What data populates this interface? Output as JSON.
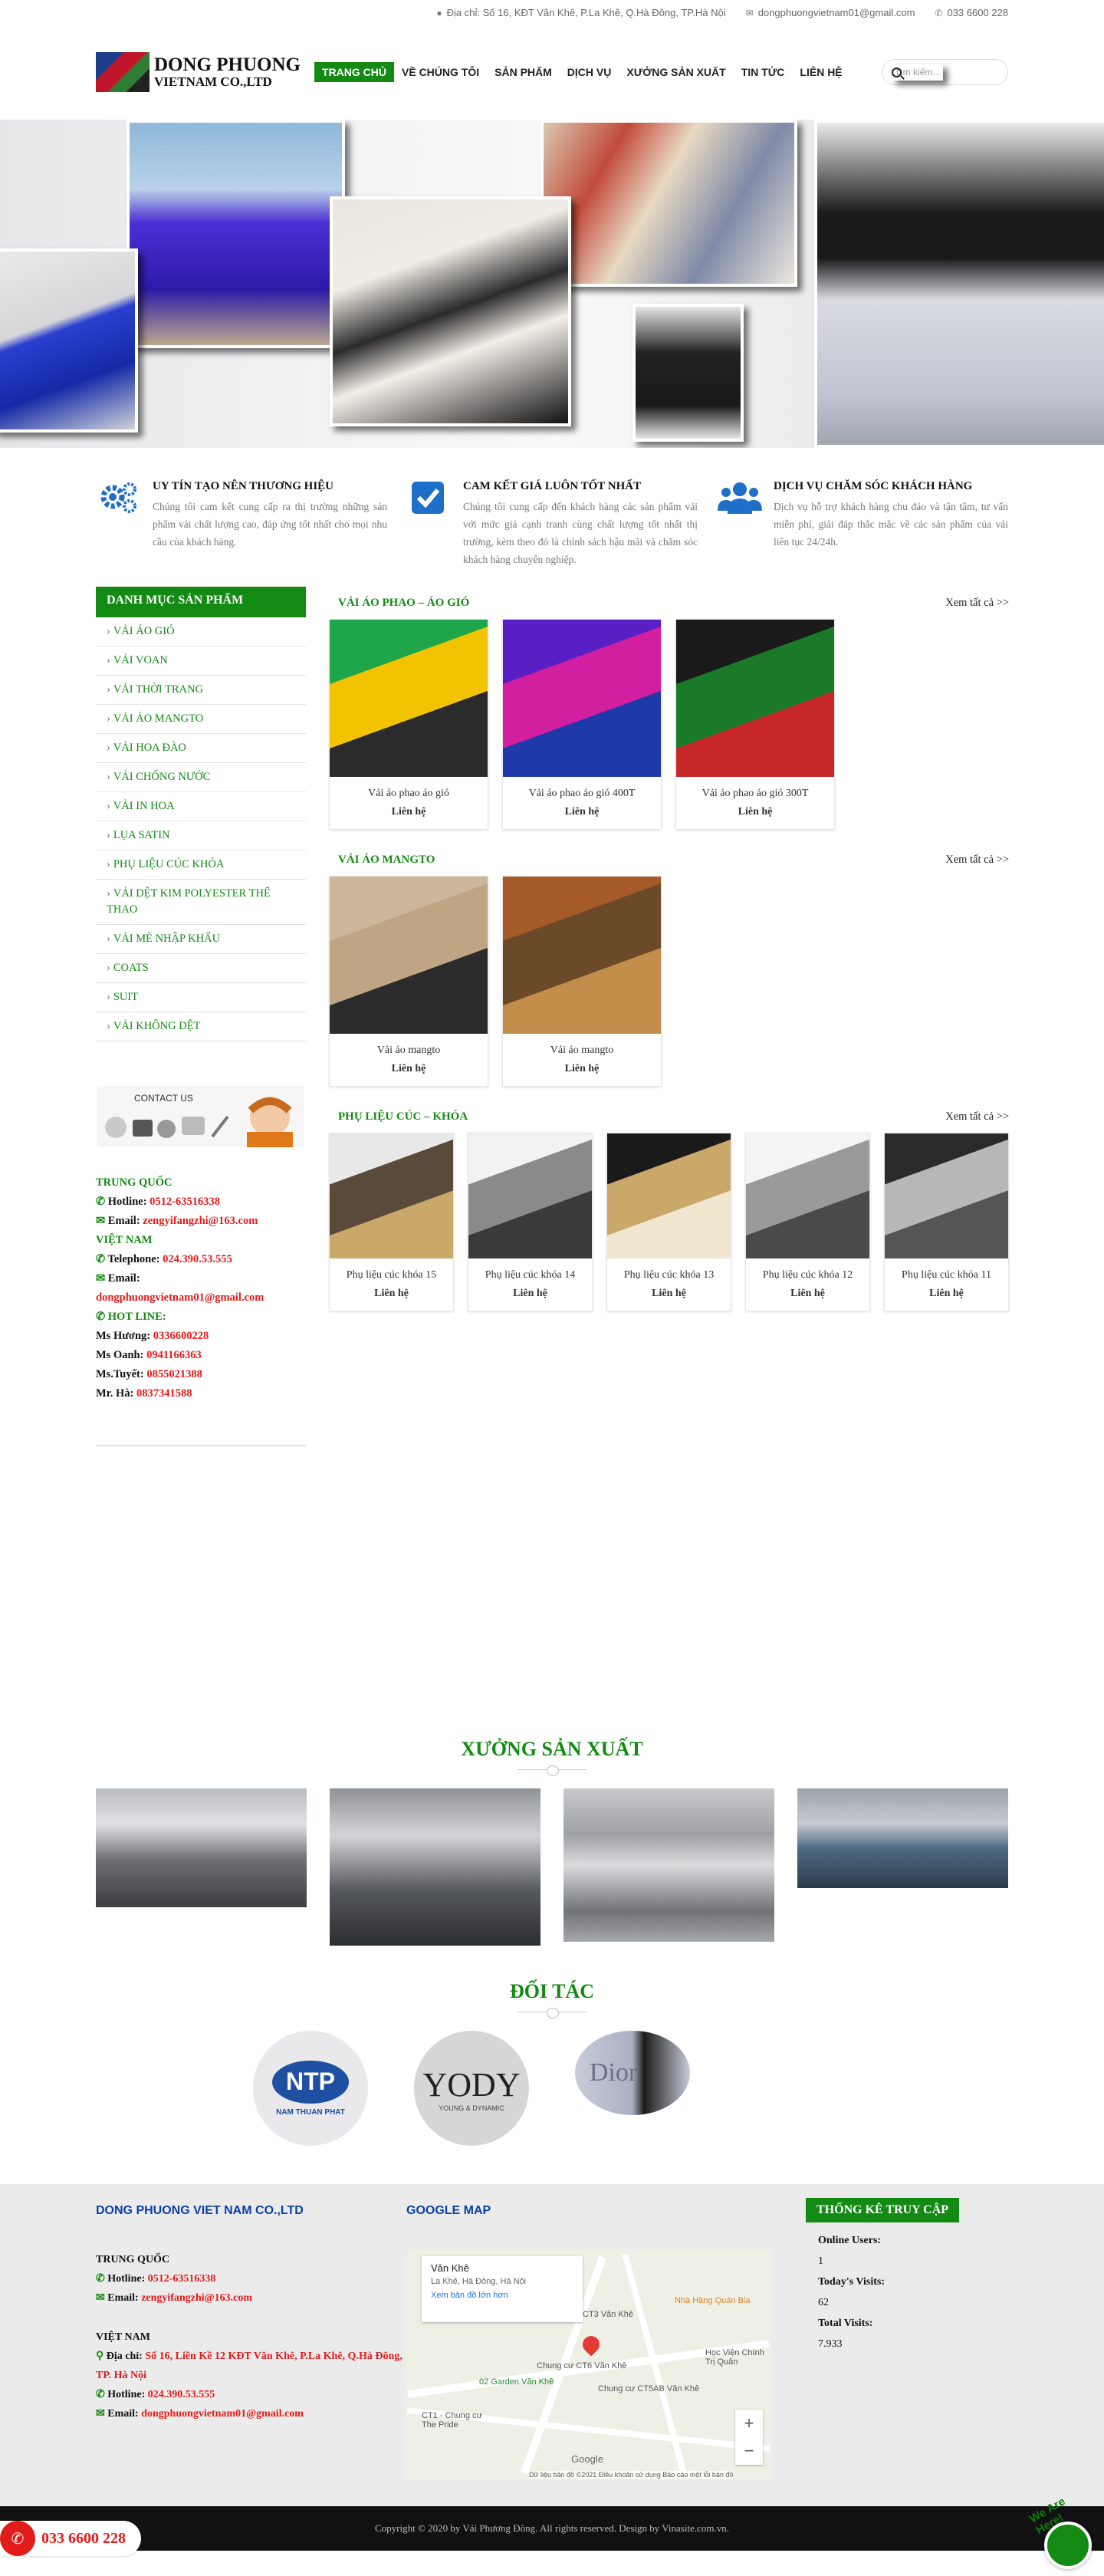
{
  "topbar": {
    "address": "Địa chỉ: Số 16, KĐT Văn Khê, P.La Khê, Q.Hà Đông, TP.Hà Nội",
    "email": "dongphuongvietnam01@gmail.com",
    "phone": "033 6600 228"
  },
  "logo": {
    "line1": "DONG PHUONG",
    "line2": "VIETNAM CO.,LTD"
  },
  "nav": [
    "TRANG CHỦ",
    "VỀ CHÚNG TÔI",
    "SẢN PHẨM",
    "DỊCH VỤ",
    "XƯỞNG SẢN XUẤT",
    "TIN TỨC",
    "LIÊN HỆ"
  ],
  "search": {
    "placeholder": "Tìm kiếm..."
  },
  "features": [
    {
      "title": "UY TÍN TẠO NÊN THƯƠNG HIỆU",
      "text": "Chúng tôi cam kết cung cấp ra thị trường những sản phẩm vải chất lượng cao, đáp ứng tốt nhất cho mọi nhu cầu của khách hàng."
    },
    {
      "title": "CAM KẾT GIÁ LUÔN TỐT NHẤT",
      "text": "Chúng tôi cung cấp đến khách hàng các sản phẩm vải với mức giá cạnh tranh cùng chất lượng tốt nhất thị trường, kèm theo đó là chính sách hậu mãi và chăm sóc khách hàng chuyên nghiệp."
    },
    {
      "title": "DỊCH VỤ CHĂM SÓC KHÁCH HÀNG",
      "text": "Dịch vụ hỗ trợ khách hàng chu đáo và tận tâm, tư vấn miễn phí, giải đáp thắc mắc về các sản phẩm của vải liên tục 24/24h."
    }
  ],
  "sidebar": {
    "title": "DANH MỤC SẢN PHẨM",
    "items": [
      "VẢI ÁO GIÓ",
      "VẢI VOAN",
      "VẢI THỜI TRANG",
      "VẢI ÁO MANGTO",
      "VẢI HOA ĐÀO",
      "VẢI CHỐNG NƯỚC",
      "VẢI IN HOA",
      "LỤA SATIN",
      "PHỤ LIỆU CÚC KHÓA",
      "VẢI DỆT KIM POLYESTER THỂ THAO",
      "VẢI MÈ NHẬP KHẨU",
      "COATS",
      "SUIT",
      "VẢI KHÔNG DỆT"
    ],
    "contact_label": "CONTACT US",
    "china": {
      "title": "TRUNG QUỐC",
      "hotline_label": "Hotline:",
      "hotline": "0512-63516338",
      "email_label": "Email:",
      "email": "zengyifangzhi@163.com"
    },
    "vietnam": {
      "title": "VIỆT NAM",
      "tel_label": "Telephone:",
      "tel": "024.390.53.555",
      "email_label": "Email:",
      "email": "dongphuongvietnam01@gmail.com"
    },
    "hotline_title": "HOT LINE:",
    "hotlines": [
      {
        "name": "Ms Hương:",
        "phone": "0336600228"
      },
      {
        "name": "Ms Oanh:",
        "phone": "0941166363"
      },
      {
        "name": "Ms.Tuyết:",
        "phone": "0855021388"
      },
      {
        "name": "Mr. Hà:",
        "phone": "0837341588"
      }
    ]
  },
  "categories": [
    {
      "title": "VẢI ÁO PHAO – ÁO GIÓ",
      "more": "Xem tất cả >>",
      "products": [
        {
          "name": "Vải áo phao áo gió",
          "price": "Liên hệ",
          "colors": [
            "#1fa64a",
            "#f2c300",
            "#2b2b2b"
          ]
        },
        {
          "name": "Vải áo phao áo gió 400T",
          "price": "Liên hệ",
          "colors": [
            "#5a1fc4",
            "#d21fa0",
            "#1e3aa8"
          ]
        },
        {
          "name": "Vải áo phao áo gió 300T",
          "price": "Liên hệ",
          "colors": [
            "#1a1a1a",
            "#1a7a2a",
            "#c62828"
          ]
        }
      ]
    },
    {
      "title": "VẢI ÁO MANGTO",
      "more": "Xem tất cả >>",
      "products": [
        {
          "name": "Vải áo mangto",
          "price": "Liên hệ",
          "colors": [
            "#cdb79a",
            "#bfa584",
            "#2c2c2c"
          ]
        },
        {
          "name": "Vải áo mangto",
          "price": "Liên hệ",
          "colors": [
            "#a55a2a",
            "#6b4a2a",
            "#c28d4a"
          ]
        }
      ]
    },
    {
      "title": "PHỤ LIỆU CÚC – KHÓA",
      "more": "Xem tất cả >>",
      "products": [
        {
          "name": "Phụ liệu cúc khóa 15",
          "price": "Liên hệ",
          "colors": [
            "#e8e8e8",
            "#5a4a3a",
            "#c9a86a"
          ]
        },
        {
          "name": "Phụ liệu cúc khóa 14",
          "price": "Liên hệ",
          "colors": [
            "#f2f2f2",
            "#8a8a8a",
            "#3a3a3a"
          ]
        },
        {
          "name": "Phụ liệu cúc khóa 13",
          "price": "Liên hệ",
          "colors": [
            "#1a1a1a",
            "#c9a86a",
            "#f1e6d0"
          ]
        },
        {
          "name": "Phụ liệu cúc khóa 12",
          "price": "Liên hệ",
          "colors": [
            "#f4f4f4",
            "#9a9a9a",
            "#4a4a4a"
          ]
        },
        {
          "name": "Phụ liệu cúc khóa 11",
          "price": "Liên hệ",
          "colors": [
            "#2a2a2a",
            "#b8b8b8",
            "#555"
          ]
        }
      ]
    }
  ],
  "factory": {
    "title": "XƯỞNG SẢN XUẤT"
  },
  "partners": {
    "title": "ĐỐI TÁC",
    "logos": [
      {
        "name": "NTP",
        "sub": "NAM THUAN PHAT"
      },
      {
        "name": "YODY",
        "sub": "YOUNG & DYNAMIC"
      },
      {
        "name": "Dior",
        "sub": ""
      }
    ]
  },
  "footer": {
    "company": "DONG PHUONG VIET NAM CO.,LTD",
    "china": {
      "title": "TRUNG QUỐC",
      "hotline_label": "Hotline:",
      "hotline": "0512-63516338",
      "email_label": "Email:",
      "email": "zengyifangzhi@163.com"
    },
    "vietnam": {
      "title": "VIỆT NAM",
      "address_label": "Địa chỉ:",
      "address": "Số 16, Liền Kề 12 KĐT Văn Khê, P.La Khê, Q.Hà Đông, TP. Hà Nội",
      "hotline_label": "Hotline:",
      "hotline": "024.390.53.555",
      "email_label": "Email:",
      "email": "dongphuongvietnam01@gmail.com"
    },
    "map_title": "GOOGLE MAP",
    "map": {
      "place": "Văn Khê",
      "address": "La Khê, Hà Đông, Hà Nội",
      "link": "Xem bản đồ lớn hơn",
      "label1": "CT3 Văn Khê",
      "label2": "Chung cư CT6 Văn Khê",
      "label3": "Chung cư CT5AB Văn Khê",
      "label4": "Nhà Hàng Quán Bia",
      "label5": "Học Viện Chính Trị Quân",
      "label6": "02 Garden Văn Khê",
      "label7": "CT1 - Chung cư The Pride",
      "label8": "Google",
      "copyright": "Dữ liệu bản đồ ©2021   Điều khoản sử dụng   Báo cáo một lỗi bản đồ"
    },
    "stats_title": "THỐNG KÊ TRUY CẬP",
    "stats": [
      {
        "label": "Online Users:",
        "value": "1"
      },
      {
        "label": "Today's Visits:",
        "value": "62"
      },
      {
        "label": "Total Visits:",
        "value": "7.933"
      }
    ],
    "copyright": "Copyright © 2020 by Vải Phương Đông. All rights reserved. Design by Vinasite.com.vn."
  },
  "float": {
    "hotline": "033 6600 228",
    "chat_tag": "We Are Here!"
  }
}
